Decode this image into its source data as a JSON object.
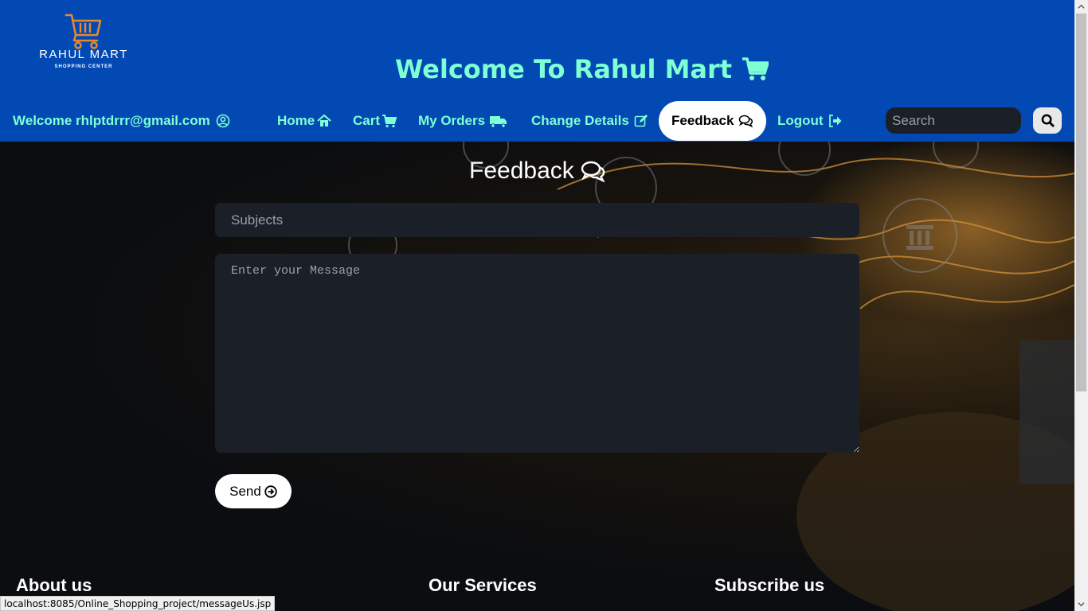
{
  "brand": {
    "logo_name": "RAHUL MART",
    "logo_sub": "SHOPPING CENTER",
    "site_title": "Welcome To Rahul Mart",
    "header_bg": "#0249b3",
    "accent": "#7fffd4"
  },
  "nav": {
    "welcome": "Welcome rhlptdrrr@gmail.com",
    "home": "Home",
    "cart": "Cart",
    "orders": "My Orders",
    "change_details": "Change Details",
    "feedback": "Feedback",
    "logout": "Logout",
    "search_placeholder": "Search"
  },
  "main": {
    "heading": "Feedback",
    "subject_placeholder": "Subjects",
    "message_placeholder": "Enter your Message",
    "send_label": "Send"
  },
  "footer": {
    "about": "About us",
    "services": "Our Services",
    "subscribe": "Subscribe us"
  },
  "status_bar": {
    "url": "localhost:8085/Online_Shopping_project/messageUs.jsp"
  },
  "icons": [
    "shopping-cart-icon",
    "user-circle-icon",
    "home-icon",
    "cart-icon",
    "truck-icon",
    "edit-icon",
    "comments-icon",
    "sign-out-icon",
    "search-icon",
    "arrow-circle-right-icon"
  ]
}
